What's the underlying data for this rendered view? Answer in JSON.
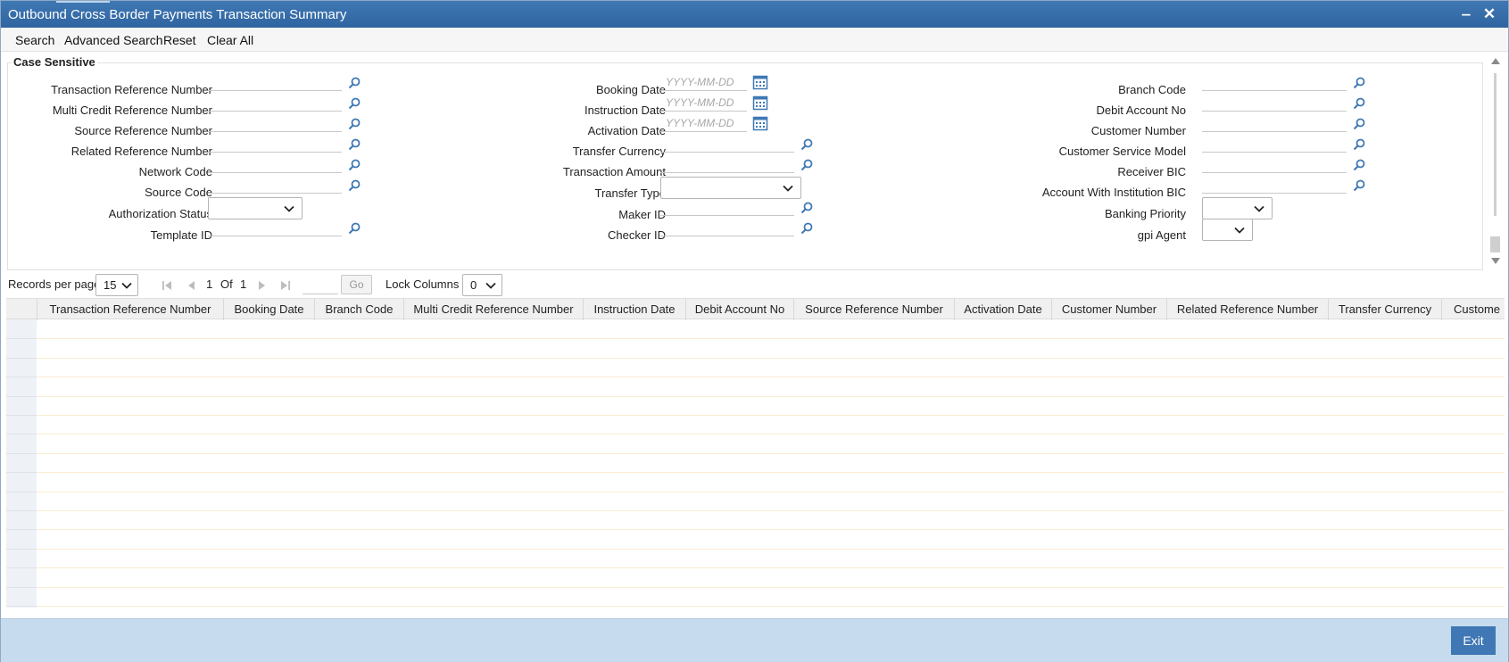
{
  "window": {
    "title": "Outbound Cross Border Payments Transaction Summary",
    "minimize_label": "‒",
    "close_label": "✕"
  },
  "toolbar": {
    "search": "Search",
    "advanced_search": "Advanced Search",
    "reset": "Reset",
    "clear_all": "Clear All"
  },
  "criteria": {
    "legend": "Case Sensitive",
    "date_placeholder": "YYYY-MM-DD",
    "col1": {
      "transaction_reference_number": "Transaction Reference Number",
      "multi_credit_reference_number": "Multi Credit Reference Number",
      "source_reference_number": "Source Reference Number",
      "related_reference_number": "Related Reference Number",
      "network_code": "Network Code",
      "source_code": "Source Code",
      "authorization_status": "Authorization Status",
      "template_id": "Template ID"
    },
    "col2": {
      "booking_date": "Booking Date",
      "instruction_date": "Instruction Date",
      "activation_date": "Activation Date",
      "transfer_currency": "Transfer Currency",
      "transaction_amount": "Transaction Amount",
      "transfer_type": "Transfer Type",
      "maker_id": "Maker ID",
      "checker_id": "Checker ID"
    },
    "col3": {
      "branch_code": "Branch Code",
      "debit_account_no": "Debit Account No",
      "customer_number": "Customer Number",
      "customer_service_model": "Customer Service Model",
      "receiver_bic": "Receiver BIC",
      "account_with_institution_bic": "Account With Institution BIC",
      "banking_priority": "Banking Priority",
      "gpi_agent": "gpi Agent"
    }
  },
  "pager": {
    "records_per_page_label": "Records per page",
    "records_per_page_value": "15",
    "current_page": "1",
    "of_label": "Of",
    "total_pages": "1",
    "go_label": "Go",
    "lock_columns_label": "Lock Columns",
    "lock_columns_value": "0"
  },
  "grid": {
    "columns": [
      "Transaction Reference Number",
      "Booking Date",
      "Branch Code",
      "Multi Credit Reference Number",
      "Instruction Date",
      "Debit Account No",
      "Source Reference Number",
      "Activation Date",
      "Customer Number",
      "Related Reference Number",
      "Transfer Currency",
      "Custome"
    ]
  },
  "footer": {
    "exit_label": "Exit"
  },
  "colors": {
    "titlebar": "#2f64a0",
    "icon_blue": "#3f78b4",
    "footer_bg": "#c6dcee"
  }
}
